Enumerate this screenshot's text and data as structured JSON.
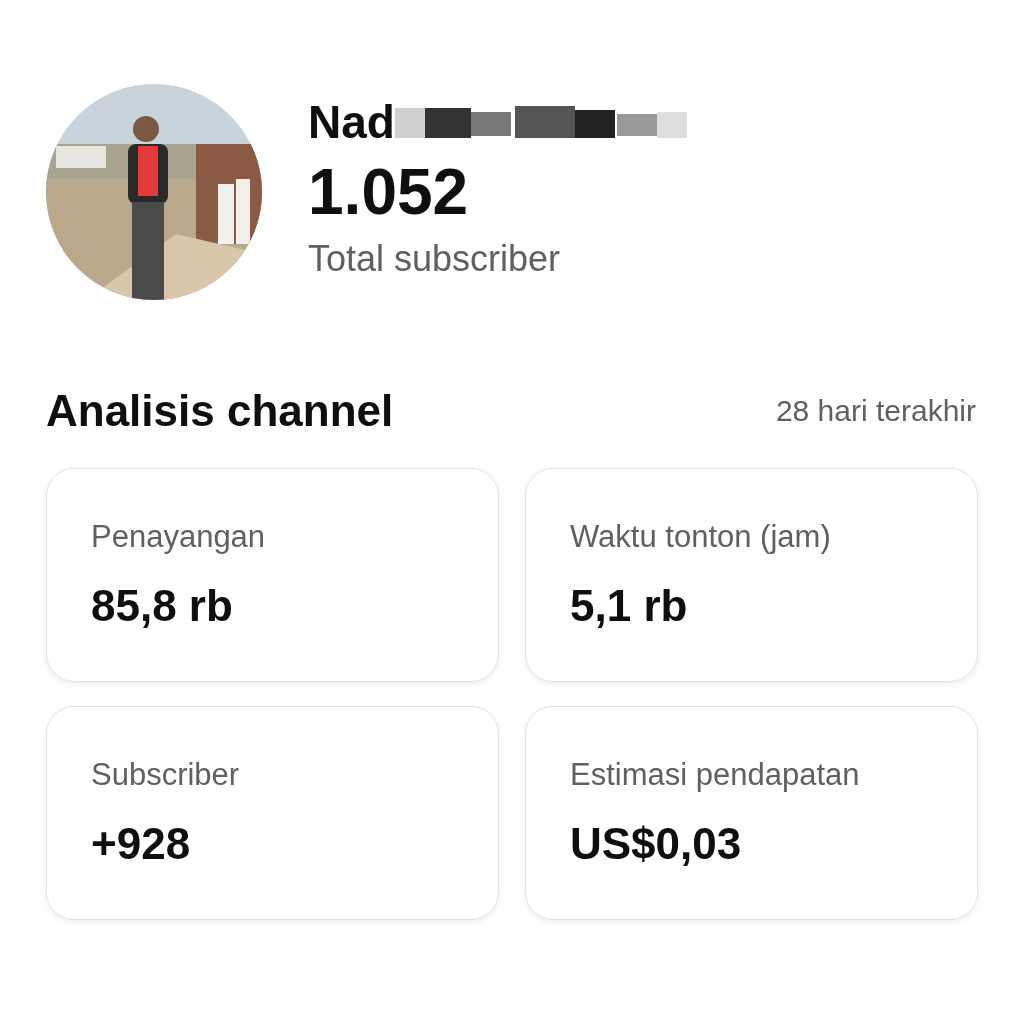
{
  "profile": {
    "name": "Nad",
    "subscriber_count": "1.052",
    "subscriber_label": "Total subscriber"
  },
  "analytics": {
    "title": "Analisis channel",
    "period": "28 hari terakhir",
    "cards": [
      {
        "label": "Penayangan",
        "value": "85,8 rb"
      },
      {
        "label": "Waktu tonton (jam)",
        "value": "5,1 rb"
      },
      {
        "label": "Subscriber",
        "value": "+928"
      },
      {
        "label": "Estimasi pendapatan",
        "value": "US$0,03"
      }
    ]
  }
}
